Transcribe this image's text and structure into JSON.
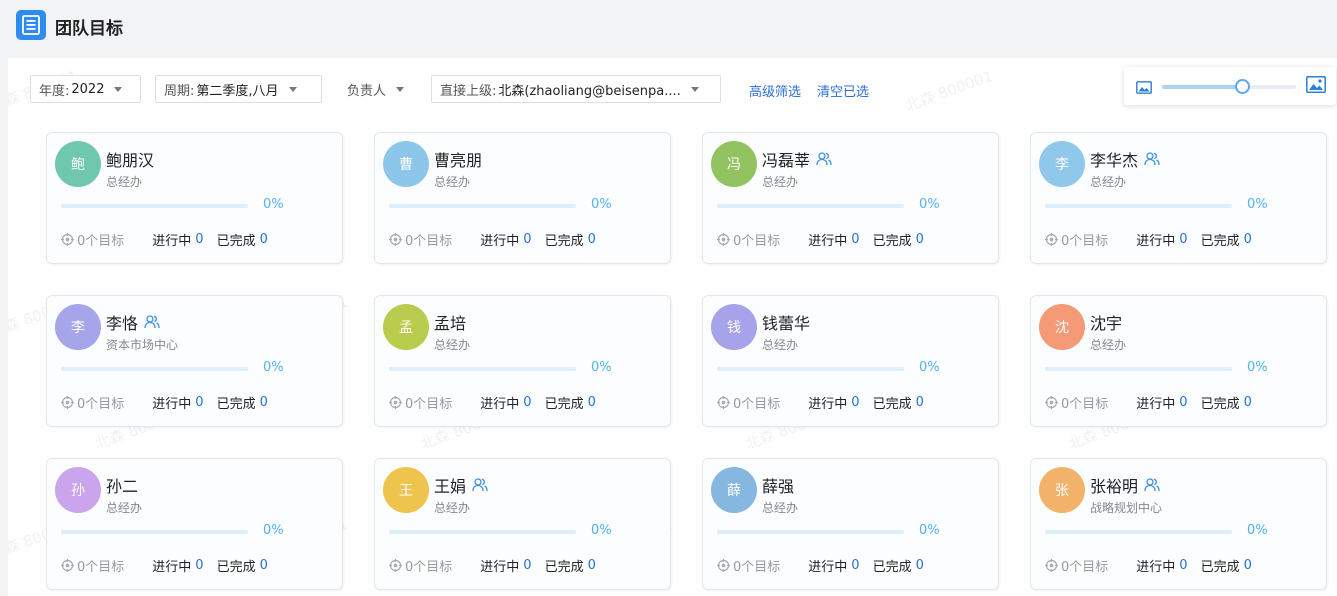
{
  "header": {
    "title": "团队目标"
  },
  "filters": {
    "year": {
      "label": "年度:",
      "value": "2022"
    },
    "period": {
      "label": "周期:",
      "value": "第二季度,八月"
    },
    "owner": {
      "label": "负责人"
    },
    "supervisor": {
      "label": "直接上级:",
      "value": "北森(zhaoliang@beisenpa...."
    },
    "advanced_label": "高级筛选",
    "clear_label": "清空已选"
  },
  "zoom": {
    "level": 0.6
  },
  "watermark": "北森 800001",
  "labels": {
    "in_progress": "进行中",
    "completed": "已完成"
  },
  "members": [
    {
      "name": "鲍朋汉",
      "avatar_text": "鲍",
      "avatar_color": "#6fc7ad",
      "dept": "总经办",
      "has_team": false,
      "progress": "0%",
      "progress_value": 0,
      "goals": "0个目标",
      "in_progress": "0",
      "completed": "0"
    },
    {
      "name": "曹亮朋",
      "avatar_text": "曹",
      "avatar_color": "#8cc7eb",
      "dept": "总经办",
      "has_team": false,
      "progress": "0%",
      "progress_value": 0,
      "goals": "0个目标",
      "in_progress": "0",
      "completed": "0"
    },
    {
      "name": "冯磊莘",
      "avatar_text": "冯",
      "avatar_color": "#93c261",
      "dept": "总经办",
      "has_team": true,
      "progress": "0%",
      "progress_value": 0,
      "goals": "0个目标",
      "in_progress": "0",
      "completed": "0"
    },
    {
      "name": "李华杰",
      "avatar_text": "李",
      "avatar_color": "#8fc8ea",
      "dept": "总经办",
      "has_team": true,
      "progress": "0%",
      "progress_value": 0,
      "goals": "0个目标",
      "in_progress": "0",
      "completed": "0"
    },
    {
      "name": "李恪",
      "avatar_text": "李",
      "avatar_color": "#a7a5ea",
      "dept": "资本市场中心",
      "has_team": true,
      "progress": "0%",
      "progress_value": 0,
      "goals": "0个目标",
      "in_progress": "0",
      "completed": "0"
    },
    {
      "name": "孟培",
      "avatar_text": "孟",
      "avatar_color": "#b9cc4e",
      "dept": "总经办",
      "has_team": false,
      "progress": "0%",
      "progress_value": 0,
      "goals": "0个目标",
      "in_progress": "0",
      "completed": "0"
    },
    {
      "name": "钱蕾华",
      "avatar_text": "钱",
      "avatar_color": "#a6a3ea",
      "dept": "总经办",
      "has_team": false,
      "progress": "0%",
      "progress_value": 0,
      "goals": "0个目标",
      "in_progress": "0",
      "completed": "0"
    },
    {
      "name": "沈宇",
      "avatar_text": "沈",
      "avatar_color": "#f49a76",
      "dept": "总经办",
      "has_team": false,
      "progress": "0%",
      "progress_value": 0,
      "goals": "0个目标",
      "in_progress": "0",
      "completed": "0"
    },
    {
      "name": "孙二",
      "avatar_text": "孙",
      "avatar_color": "#caa4ec",
      "dept": "总经办",
      "has_team": false,
      "progress": "0%",
      "progress_value": 0,
      "goals": "0个目标",
      "in_progress": "0",
      "completed": "0"
    },
    {
      "name": "王娟",
      "avatar_text": "王",
      "avatar_color": "#efc44e",
      "dept": "总经办",
      "has_team": true,
      "progress": "0%",
      "progress_value": 0,
      "goals": "0个目标",
      "in_progress": "0",
      "completed": "0"
    },
    {
      "name": "薛强",
      "avatar_text": "薛",
      "avatar_color": "#86b7e0",
      "dept": "总经办",
      "has_team": false,
      "progress": "0%",
      "progress_value": 0,
      "goals": "0个目标",
      "in_progress": "0",
      "completed": "0"
    },
    {
      "name": "张裕明",
      "avatar_text": "张",
      "avatar_color": "#f2b26a",
      "dept": "战略规划中心",
      "has_team": true,
      "progress": "0%",
      "progress_value": 0,
      "goals": "0个目标",
      "in_progress": "0",
      "completed": "0"
    }
  ]
}
